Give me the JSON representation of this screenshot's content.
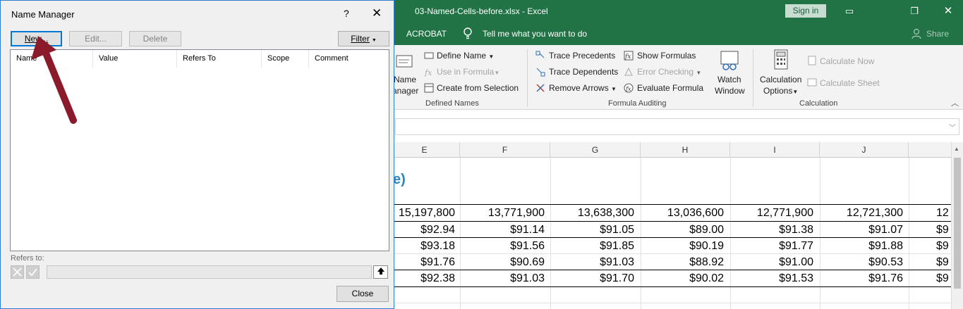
{
  "excel": {
    "window_title": "03-Named-Cells-before.xlsx  -  Excel",
    "signin_label": "Sign in",
    "tabs": {
      "acrobat": "ACROBAT",
      "tell_me": "Tell me what you want to do",
      "share": "Share"
    },
    "ribbon": {
      "name_manager_line1": "Name",
      "name_manager_line2": "anager",
      "define_name": "Define Name",
      "use_in_formula": "Use in Formula",
      "create_from_selection": "Create from Selection",
      "defined_names_group": "Defined Names",
      "trace_precedents": "Trace Precedents",
      "trace_dependents": "Trace Dependents",
      "remove_arrows": "Remove Arrows",
      "show_formulas": "Show Formulas",
      "error_checking": "Error Checking",
      "evaluate_formula": "Evaluate Formula",
      "watch_window_line1": "Watch",
      "watch_window_line2": "Window",
      "formula_auditing_group": "Formula Auditing",
      "calc_options_line1": "Calculation",
      "calc_options_line2": "Options",
      "calculate_now": "Calculate Now",
      "calculate_sheet": "Calculate Sheet",
      "calculation_group": "Calculation"
    },
    "columns": [
      "E",
      "F",
      "G",
      "H",
      "I",
      "J"
    ],
    "heading_fragment": "e)",
    "rows": [
      [
        "15,197,800",
        "13,771,900",
        "13,638,300",
        "13,036,600",
        "12,771,900",
        "12,721,300",
        "12"
      ],
      [
        "$92.94",
        "$91.14",
        "$91.05",
        "$89.00",
        "$91.38",
        "$91.07",
        "$9"
      ],
      [
        "$93.18",
        "$91.56",
        "$91.85",
        "$90.19",
        "$91.77",
        "$91.88",
        "$9"
      ],
      [
        "$91.76",
        "$90.69",
        "$91.03",
        "$88.92",
        "$91.00",
        "$90.53",
        "$9"
      ],
      [
        "$92.38",
        "$91.03",
        "$91.70",
        "$90.02",
        "$91.53",
        "$91.76",
        "$9"
      ]
    ],
    "accent_color": "#217346"
  },
  "dialog": {
    "title": "Name Manager",
    "help": "?",
    "close_x": "✕",
    "buttons": {
      "new": "New...",
      "edit": "Edit...",
      "delete": "Delete",
      "filter": "Filter",
      "close": "Close"
    },
    "list_headers": [
      "Name",
      "Value",
      "Refers To",
      "Scope",
      "Comment"
    ],
    "refers_to_label": "Refers to:"
  },
  "annotation": {
    "arrow_color": "#8b1a2b"
  }
}
